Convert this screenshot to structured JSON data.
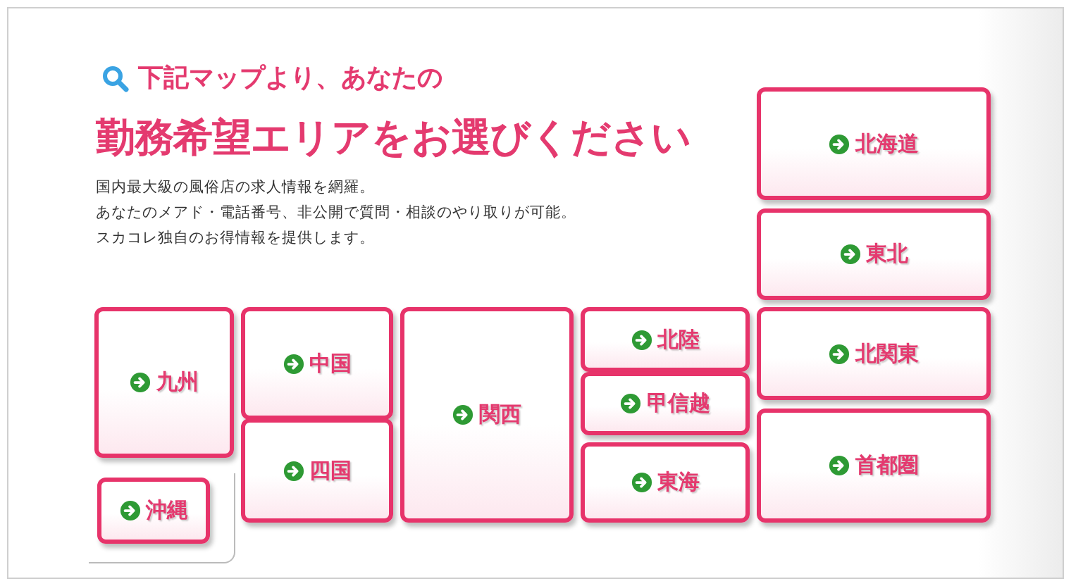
{
  "heading": {
    "lead": "下記マップより、あなたの",
    "title": "勤務希望エリアをお選びください"
  },
  "intro": [
    "国内最大級の風俗店の求人情報を網羅。",
    "あなたのメアド・電話番号、非公開で質問・相談のやり取りが可能。",
    "スカコレ独自のお得情報を提供します。"
  ],
  "regions": [
    {
      "label": "北海道"
    },
    {
      "label": "東北"
    },
    {
      "label": "九州"
    },
    {
      "label": "中国"
    },
    {
      "label": "関西"
    },
    {
      "label": "北陸"
    },
    {
      "label": "北関東"
    },
    {
      "label": "甲信越"
    },
    {
      "label": "四国"
    },
    {
      "label": "首都圏"
    },
    {
      "label": "東海"
    },
    {
      "label": "沖縄"
    }
  ]
}
